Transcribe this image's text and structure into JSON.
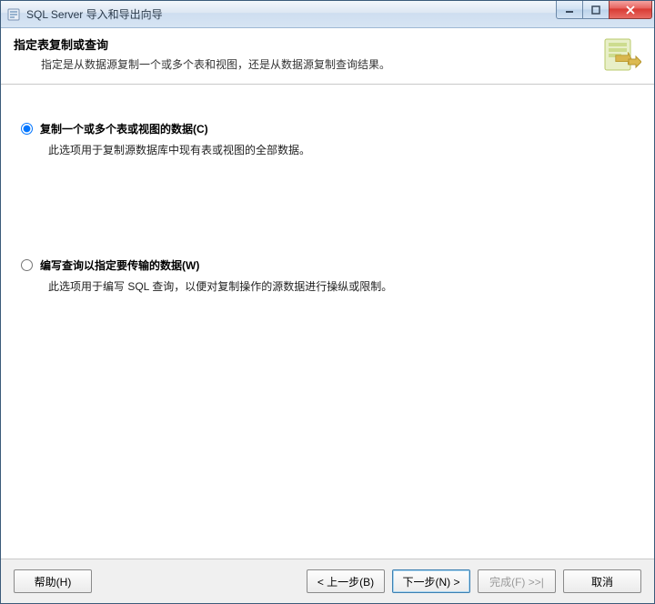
{
  "window": {
    "title": "SQL Server 导入和导出向导"
  },
  "header": {
    "title": "指定表复制或查询",
    "subtitle": "指定是从数据源复制一个或多个表和视图，还是从数据源复制查询结果。"
  },
  "options": {
    "copy": {
      "label": "复制一个或多个表或视图的数据(C)",
      "description": "此选项用于复制源数据库中现有表或视图的全部数据。",
      "checked": true
    },
    "query": {
      "label": "编写查询以指定要传输的数据(W)",
      "description": "此选项用于编写 SQL 查询，以便对复制操作的源数据进行操纵或限制。",
      "checked": false
    }
  },
  "footer": {
    "help": "帮助(H)",
    "back": "< 上一步(B)",
    "next": "下一步(N) >",
    "finish": "完成(F) >>|",
    "cancel": "取消"
  }
}
